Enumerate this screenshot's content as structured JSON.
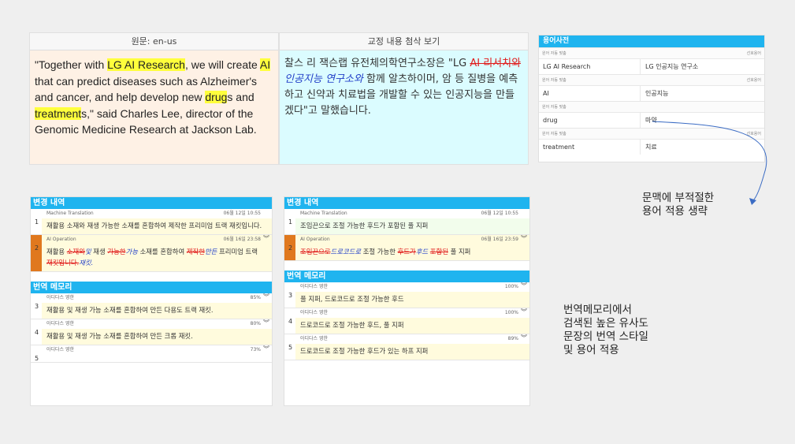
{
  "source": {
    "header": "원문: en-us",
    "segments": [
      {
        "text": "\"Together with ",
        "hl": false
      },
      {
        "text": "LG AI Research",
        "hl": true
      },
      {
        "text": ", we will create ",
        "hl": false
      },
      {
        "text": "AI",
        "hl": true
      },
      {
        "text": " that can predict diseases such as Alzheimer's and cancer, and help develop new ",
        "hl": false
      },
      {
        "text": "drug",
        "hl": true
      },
      {
        "text": "s and ",
        "hl": false
      },
      {
        "text": "treatment",
        "hl": true
      },
      {
        "text": "s,\" said Charles Lee, director of the Genomic Medicine Research at Jackson Lab.",
        "hl": false
      }
    ]
  },
  "revision": {
    "header": "교정 내용 첨삭 보기",
    "segments": [
      {
        "text": "찰스 리 잭슨랩 유전체의학연구소장은 \"LG ",
        "type": "normal"
      },
      {
        "text": "AI 리서치와",
        "type": "del"
      },
      {
        "text": "인공지능 연구소와",
        "type": "ins"
      },
      {
        "text": " 함께 알츠하이머, 암 등 질병을 예측하고 신약과 치료법을 개발할 수 있는 인공지능을 만들겠다\"고 말했습니다.",
        "type": "normal"
      }
    ]
  },
  "glossary": {
    "title": "용어사전",
    "entries": [
      {
        "source_label": "원어 자동 맞춤",
        "target_label": "선호용어",
        "source": "LG AI Research",
        "target": "LG 인공지능 연구소"
      },
      {
        "source_label": "원어 자동 맞춤",
        "target_label": "선호용어",
        "source": "AI",
        "target": "인공지능"
      },
      {
        "source_label": "원어 자동 맞춤",
        "target_label": "",
        "source": "drug",
        "target": "마약"
      },
      {
        "source_label": "원어 자동 맞춤",
        "target_label": "선호용어",
        "source": "treatment",
        "target": "치료"
      }
    ]
  },
  "left_panel": {
    "history_title": "변경 내역",
    "history": [
      {
        "num": "1",
        "label": "Machine Translation",
        "date": "06월 12일 10:55",
        "text": "재활용 소재와 재생 가능한 소재를 혼합하여 제작한 프리미엄 트랙 재킷입니다."
      },
      {
        "num": "2",
        "label": "AI Operation",
        "date": "06월 16일 23:58",
        "segments": [
          {
            "text": "재활용 ",
            "type": "normal"
          },
          {
            "text": "소재와",
            "type": "del"
          },
          {
            "text": "및",
            "type": "ins"
          },
          {
            "text": " 재생 ",
            "type": "normal"
          },
          {
            "text": "가능한",
            "type": "del"
          },
          {
            "text": "가능",
            "type": "ins"
          },
          {
            "text": " 소재를 혼합하여 ",
            "type": "normal"
          },
          {
            "text": "제작한",
            "type": "del"
          },
          {
            "text": "만든",
            "type": "ins"
          },
          {
            "text": " 프리미엄 트랙 ",
            "type": "normal"
          },
          {
            "text": "재킷입니다.",
            "type": "del"
          },
          {
            "text": "재킷.",
            "type": "ins"
          }
        ]
      }
    ],
    "tm_title": "번역 메모리",
    "tm": [
      {
        "num": "3",
        "label": "아디다스 영한",
        "score": "85%",
        "text": "재활용 및 재생 가능 소재를 혼합하여 만든 다용도 트랙 재킷."
      },
      {
        "num": "4",
        "label": "아디다스 영한",
        "score": "80%",
        "text": "재활용 및 재생 가능 소재를 혼합하여 만든 크롭 재킷."
      },
      {
        "num": "5",
        "label": "아디다스 영한",
        "score": "73%",
        "text": ""
      }
    ]
  },
  "right_panel": {
    "history_title": "변경 내역",
    "history": [
      {
        "num": "1",
        "label": "Machine Translation",
        "date": "06월 12일 10:55",
        "text": "조임끈으로 조절 가능한 후드가 포함된 풀 지퍼"
      },
      {
        "num": "2",
        "label": "AI Operation",
        "date": "06월 16일 23:59",
        "segments": [
          {
            "text": "조임끈으로",
            "type": "del"
          },
          {
            "text": "드로코드로",
            "type": "ins"
          },
          {
            "text": " 조절 가능한 ",
            "type": "normal"
          },
          {
            "text": "후드가",
            "type": "del"
          },
          {
            "text": "후드",
            "type": "ins"
          },
          {
            "text": " ",
            "type": "normal"
          },
          {
            "text": "포함된",
            "type": "del"
          },
          {
            "text": " 풀 지퍼",
            "type": "normal"
          }
        ]
      }
    ],
    "tm_title": "번역 메모리",
    "tm": [
      {
        "num": "3",
        "label": "아디다스 영한",
        "score": "100%",
        "text": "풀 지퍼, 드로코드로 조절 가능한 후드"
      },
      {
        "num": "4",
        "label": "아디다스 영한",
        "score": "100%",
        "text": "드로코드로 조절 가능한 후드, 풀 지퍼"
      },
      {
        "num": "5",
        "label": "아디다스 영한",
        "score": "89%",
        "text": "드로코드로 조절 가능한 후드가 있는 하프 지퍼"
      }
    ]
  },
  "annotations": {
    "glossary_note": [
      "문맥에 부적절한",
      "용어 적용 생략"
    ],
    "tm_note": [
      "번역메모리에서",
      "검색된 높은 유사도",
      "문장의 번역 스타일",
      "및 용어 적용"
    ]
  }
}
